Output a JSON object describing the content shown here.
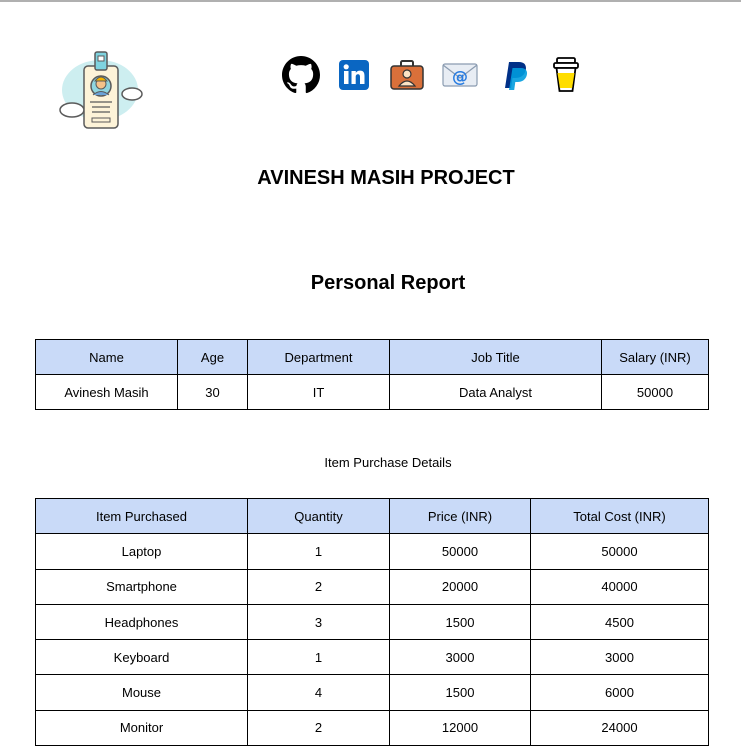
{
  "header": {
    "title": "AVINESH MASIH PROJECT",
    "social_icons": [
      "github-icon",
      "linkedin-icon",
      "portfolio-icon",
      "email-icon",
      "paypal-icon",
      "buy-me-a-coffee-icon"
    ]
  },
  "personal": {
    "title": "Personal Report",
    "headers": [
      "Name",
      "Age",
      "Department",
      "Job Title",
      "Salary (INR)"
    ],
    "rows": [
      [
        "Avinesh Masih",
        "30",
        "IT",
        "Data Analyst",
        "50000"
      ]
    ]
  },
  "purchases": {
    "caption": "Item Purchase Details",
    "headers": [
      "Item Purchased",
      "Quantity",
      "Price (INR)",
      "Total Cost (INR)"
    ],
    "rows": [
      [
        "Laptop",
        "1",
        "50000",
        "50000"
      ],
      [
        "Smartphone",
        "2",
        "20000",
        "40000"
      ],
      [
        "Headphones",
        "3",
        "1500",
        "4500"
      ],
      [
        "Keyboard",
        "1",
        "3000",
        "3000"
      ],
      [
        "Mouse",
        "4",
        "1500",
        "6000"
      ],
      [
        "Monitor",
        "2",
        "12000",
        "24000"
      ]
    ]
  },
  "colors": {
    "header_fill": "#c9daf8",
    "linkedin": "#0a66c2",
    "paypal_dark": "#003087",
    "paypal_light": "#009cde"
  }
}
